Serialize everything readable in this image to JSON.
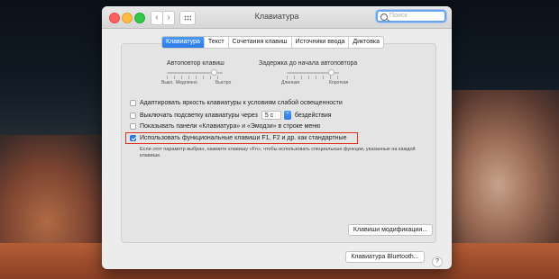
{
  "window": {
    "title": "Клавиатура"
  },
  "search": {
    "placeholder": "Поиск"
  },
  "nav": {
    "back": "‹",
    "forward": "›"
  },
  "tabs": [
    {
      "label": "Клавиатура",
      "active": true
    },
    {
      "label": "Текст",
      "active": false
    },
    {
      "label": "Сочетания клавиш",
      "active": false
    },
    {
      "label": "Источники ввода",
      "active": false
    },
    {
      "label": "Диктовка",
      "active": false
    }
  ],
  "key_repeat": {
    "title": "Автоповтор клавиш",
    "labels": [
      "Выкл.",
      "Медленно",
      "Быстро"
    ],
    "value": 0.85
  },
  "repeat_delay": {
    "title": "Задержка до начала автоповтора",
    "labels": [
      "Длинная",
      "Короткая"
    ],
    "value": 0.85
  },
  "options": {
    "adjust_brightness": {
      "label": "Адаптировать яркость клавиатуры к условиям слабой освещенности",
      "checked": false
    },
    "backlight_off": {
      "label_before": "Выключать подсветку клавиатуры через",
      "value": "5 с",
      "label_after": "бездействия",
      "checked": false
    },
    "show_panels": {
      "label": "Показывать панели «Клавиатура» и «Эмодзи» в строке меню",
      "checked": false
    },
    "fn_keys": {
      "label": "Использовать функциональные клавиши F1, F2 и др. как стандартные",
      "checked": true
    }
  },
  "hint": "Если этот параметр выбран, нажмите клавишу «Fn», чтобы использовать специальные функции, указанные на каждой клавише.",
  "buttons": {
    "modifier_keys": "Клавиши модификации...",
    "bluetooth": "Клавиатура Bluetooth...",
    "help": "?"
  }
}
